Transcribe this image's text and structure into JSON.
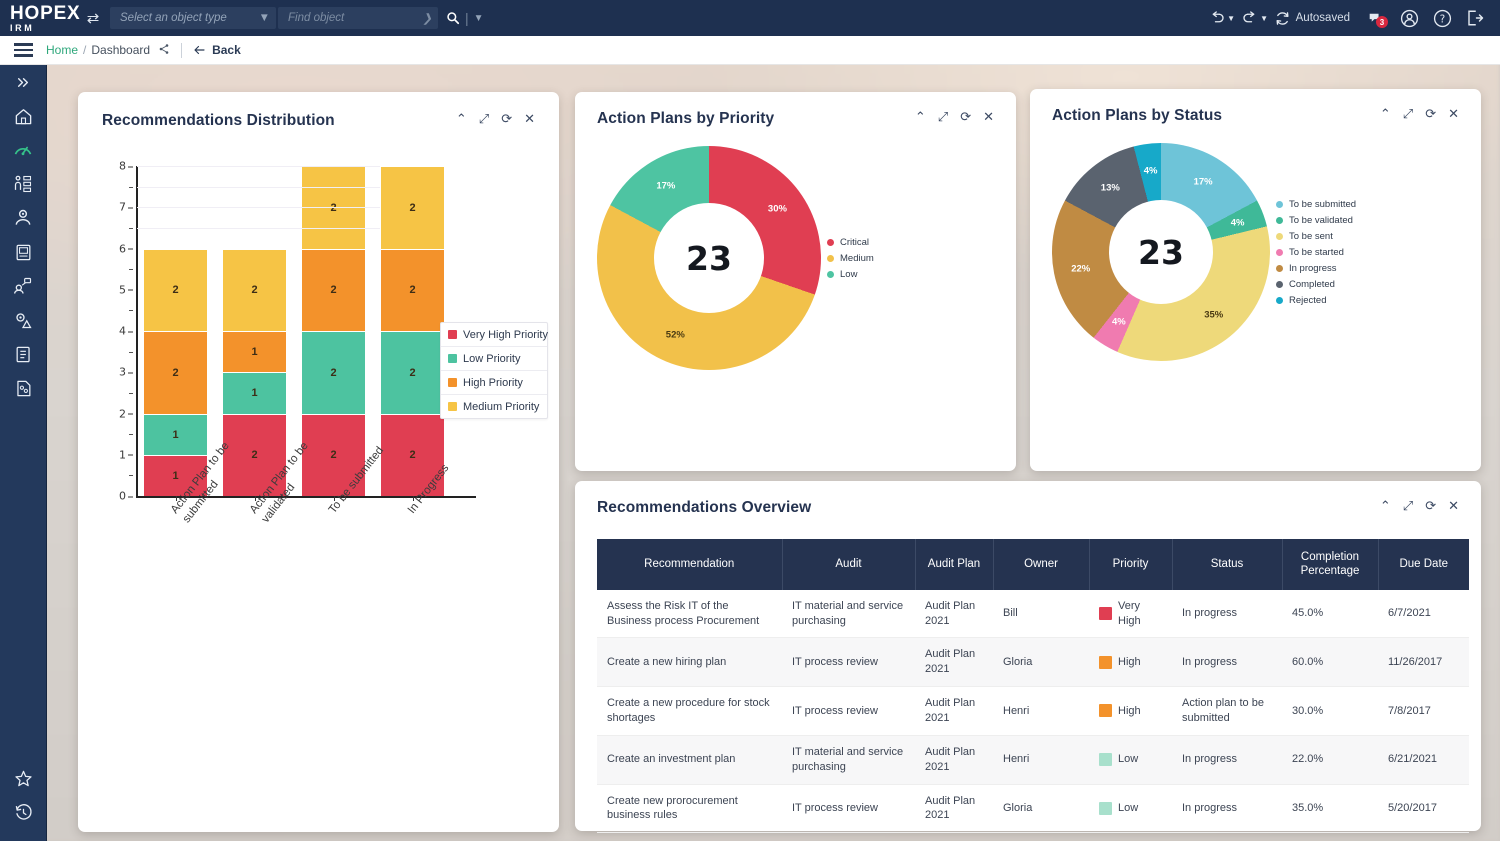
{
  "topbar": {
    "logo_main": "HOPEX",
    "logo_sub": "IRM",
    "swap_icon": "swap-icon",
    "object_type_placeholder": "Select an object type",
    "find_placeholder": "Find object",
    "search_icon": "search-icon",
    "undo_icon": "undo-icon",
    "redo_icon": "redo-icon",
    "refresh_icon": "refresh-icon",
    "autosaved_label": "Autosaved",
    "notifications_icon": "notification-icon",
    "notifications_count": "3",
    "account_icon": "account-icon",
    "help_icon": "help-icon",
    "logout_icon": "logout-icon"
  },
  "breadcrumb": {
    "menu_icon": "hamburger-menu-icon",
    "home": "Home",
    "separator": "/",
    "current": "Dashboard",
    "share_icon": "share-icon",
    "back_label": "Back",
    "back_icon": "arrow-left-icon"
  },
  "rail": {
    "items": [
      {
        "icon": "double-chevron-right-icon",
        "name": "expand-rail"
      },
      {
        "icon": "home-icon",
        "name": "home"
      },
      {
        "icon": "dashboard-gauge-icon",
        "name": "dashboard",
        "active": true
      },
      {
        "icon": "people-process-icon",
        "name": "organization"
      },
      {
        "icon": "risk-person-icon",
        "name": "risks"
      },
      {
        "icon": "report-book-icon",
        "name": "reports"
      },
      {
        "icon": "process-flow-icon",
        "name": "processes"
      },
      {
        "icon": "gear-warning-icon",
        "name": "controls"
      },
      {
        "icon": "checklist-icon",
        "name": "audits"
      },
      {
        "icon": "document-chart-icon",
        "name": "documents"
      }
    ],
    "bottom_items": [
      {
        "icon": "star-icon",
        "name": "favorites"
      },
      {
        "icon": "history-clock-icon",
        "name": "history"
      }
    ]
  },
  "panel_controls": {
    "collapse_icon": "chevron-up-icon",
    "expand_icon": "expand-diagonal-icon",
    "refresh_icon": "refresh-icon",
    "close_icon": "close-icon"
  },
  "panels": {
    "distribution": {
      "title": "Recommendations Distribution"
    },
    "priority": {
      "title": "Action Plans by Priority"
    },
    "status": {
      "title": "Action Plans by Status"
    },
    "overview": {
      "title": "Recommendations Overview"
    }
  },
  "chart_data": [
    {
      "type": "bar",
      "name": "recommendations-distribution",
      "title": "Recommendations Distribution",
      "stacked": true,
      "categories": [
        "Action Plan to be submitted",
        "Action Plan to be validated",
        "To be submitted",
        "In Progress"
      ],
      "series": [
        {
          "name": "Very High Priority",
          "color": "#e03e52",
          "values": [
            1,
            2,
            2,
            2
          ]
        },
        {
          "name": "Low Priority",
          "color": "#4dc3a0",
          "values": [
            1,
            1,
            2,
            2
          ]
        },
        {
          "name": "High Priority",
          "color": "#f3922b",
          "values": [
            2,
            1,
            2,
            2
          ]
        },
        {
          "name": "Medium Priority",
          "color": "#f6c445",
          "values": [
            2,
            2,
            2,
            2
          ]
        }
      ],
      "totals": [
        6,
        6,
        8,
        8
      ],
      "xlabel": "",
      "ylabel": "",
      "ylim": [
        0,
        8
      ],
      "yticks": [
        0,
        1,
        2,
        3,
        4,
        5,
        6,
        7,
        8
      ],
      "grid": true,
      "legend_position": "right"
    },
    {
      "type": "pie",
      "name": "action-plans-by-priority",
      "title": "Action Plans by Priority",
      "donut": true,
      "center_value": "23",
      "labels": [
        "Critical",
        "Medium",
        "Low"
      ],
      "values": [
        30,
        52,
        17
      ],
      "display_labels": [
        "30%",
        "52%",
        "17%"
      ],
      "colors": [
        "#e03e52",
        "#f2c14a",
        "#4ec4a2"
      ],
      "legend_position": "right"
    },
    {
      "type": "pie",
      "name": "action-plans-by-status",
      "title": "Action Plans by Status",
      "donut": true,
      "center_value": "23",
      "labels": [
        "To be submitted",
        "To be validated",
        "To be sent",
        "To be started",
        "In progress",
        "Completed",
        "Rejected"
      ],
      "values": [
        17,
        4,
        35,
        4,
        22,
        13,
        4
      ],
      "display_labels": [
        "17%",
        "4%",
        "35%",
        "4%",
        "22%",
        "13%",
        "4%"
      ],
      "colors": [
        "#6ec4d8",
        "#3fb998",
        "#eed97a",
        "#f07bb0",
        "#c08b43",
        "#5a636f",
        "#17a9c9"
      ],
      "legend_position": "right"
    }
  ],
  "table": {
    "columns": [
      "Recommendation",
      "Audit",
      "Audit Plan",
      "Owner",
      "Priority",
      "Status",
      "Completion Percentage",
      "Due Date"
    ],
    "rows": [
      {
        "recommendation": "Assess the Risk IT of the Business process Procurement",
        "audit": "IT material and service purchasing",
        "audit_plan": "Audit Plan 2021",
        "owner": "Bill",
        "priority": "Very High",
        "priority_color": "#e03e52",
        "status": "In progress",
        "completion": "45.0%",
        "due_date": "6/7/2021"
      },
      {
        "recommendation": "Create a new hiring plan",
        "audit": "IT process review",
        "audit_plan": "Audit Plan 2021",
        "owner": "Gloria",
        "priority": "High",
        "priority_color": "#f3922b",
        "status": "In progress",
        "completion": "60.0%",
        "due_date": "11/26/2017"
      },
      {
        "recommendation": "Create a new procedure for stock shortages",
        "audit": "IT process review",
        "audit_plan": "Audit Plan 2021",
        "owner": "Henri",
        "priority": "High",
        "priority_color": "#f3922b",
        "status": "Action plan to be submitted",
        "completion": "30.0%",
        "due_date": "7/8/2017"
      },
      {
        "recommendation": "Create an investment plan",
        "audit": "IT material and service purchasing",
        "audit_plan": "Audit Plan 2021",
        "owner": "Henri",
        "priority": "Low",
        "priority_color": "#a8e0cc",
        "status": "In progress",
        "completion": "22.0%",
        "due_date": "6/21/2021"
      },
      {
        "recommendation": "Create new prorocurement business rules",
        "audit": "IT process review",
        "audit_plan": "Audit Plan 2021",
        "owner": "Gloria",
        "priority": "Low",
        "priority_color": "#a8e0cc",
        "status": "In progress",
        "completion": "35.0%",
        "due_date": "5/20/2017"
      }
    ]
  }
}
